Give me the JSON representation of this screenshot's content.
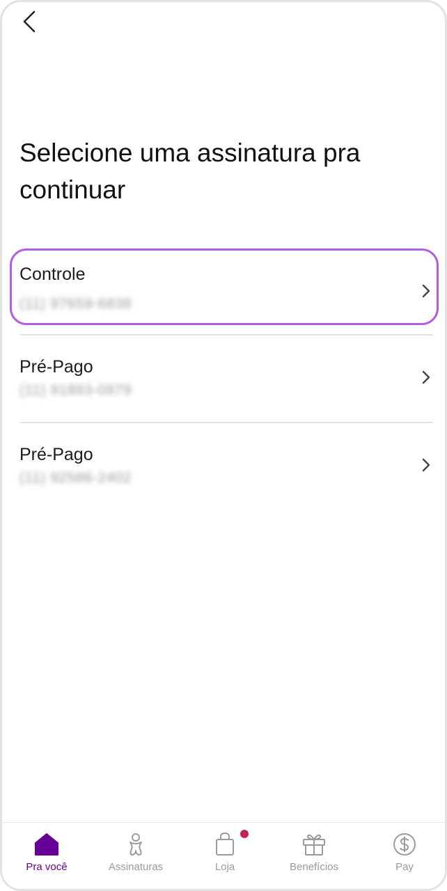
{
  "header": {
    "back_icon": "chevron-left-icon"
  },
  "title": "Selecione uma assinatura pra continuar",
  "subscriptions": [
    {
      "label": "Controle",
      "number": "(11) 97659-6838",
      "selected": true,
      "icon": "chevron-right-icon"
    },
    {
      "label": "Pré-Pago",
      "number": "(11) 91893-0979",
      "selected": false,
      "icon": "chevron-right-icon"
    },
    {
      "label": "Pré-Pago",
      "number": "(11) 92586-2402",
      "selected": false,
      "icon": "chevron-right-icon"
    }
  ],
  "nav": {
    "items": [
      {
        "label": "Pra você",
        "icon": "home-icon",
        "active": true
      },
      {
        "label": "Assinaturas",
        "icon": "vivo-person-icon",
        "active": false
      },
      {
        "label": "Loja",
        "icon": "shopping-bag-icon",
        "active": false,
        "badge": true
      },
      {
        "label": "Benefícios",
        "icon": "gift-icon",
        "active": false
      },
      {
        "label": "Pay",
        "icon": "dollar-coin-icon",
        "active": false
      }
    ]
  },
  "colors": {
    "accent": "#660099",
    "selected_border": "#b35ee0",
    "badge": "#c0215f",
    "inactive": "#9a9a9a"
  }
}
